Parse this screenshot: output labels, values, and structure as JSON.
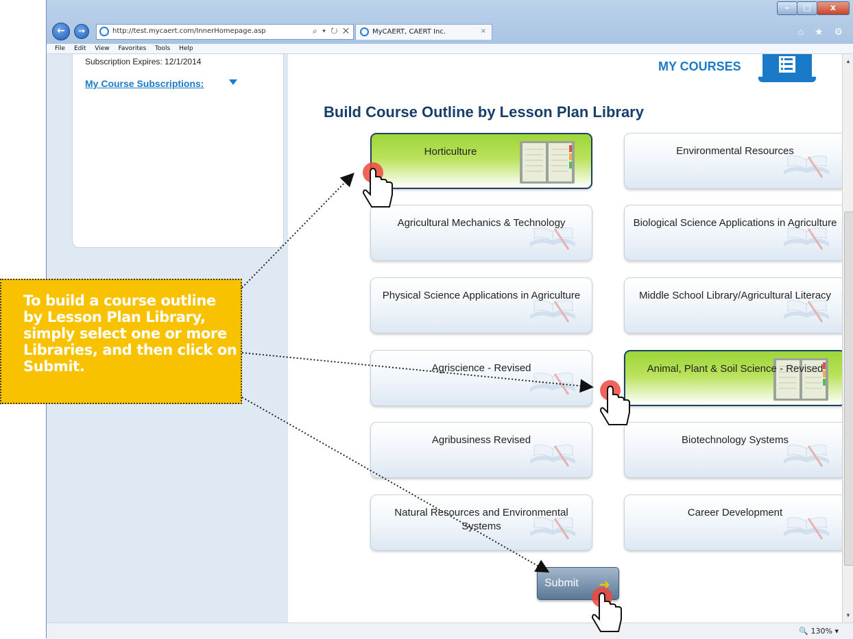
{
  "browser": {
    "url": "http://test.mycaert.com/InnerHomepage.asp",
    "tab_title": "MyCAERT, CAERT Inc.",
    "tab_close": "×",
    "address_controls": "⌕ ▾ ↻ ✕",
    "window_buttons": [
      "–",
      "□",
      "x"
    ],
    "nav": {
      "back": "←",
      "forward": "→"
    },
    "toolbar_icons": "⌂ ★ ⚙",
    "menu": [
      "File",
      "Edit",
      "View",
      "Favorites",
      "Tools",
      "Help"
    ],
    "zoom": "130%"
  },
  "sidebar": {
    "subscription_expires": "Subscription Expires: 12/1/2014",
    "my_course_subscriptions": "My Course Subscriptions:"
  },
  "header": {
    "my_courses": "MY COURSES",
    "page_heading": "Build Course Outline by Lesson Plan Library"
  },
  "libraries": [
    {
      "label": "Horticulture",
      "selected": true
    },
    {
      "label": "Environmental Resources",
      "selected": false
    },
    {
      "label": "Agricultural Mechanics & Technology",
      "selected": false
    },
    {
      "label": "Biological Science Applications in Agriculture",
      "selected": false
    },
    {
      "label": "Physical Science Applications in Agriculture",
      "selected": false
    },
    {
      "label": "Middle School Library/Agricultural Literacy",
      "selected": false
    },
    {
      "label": "Agriscience - Revised",
      "selected": false
    },
    {
      "label": "Animal, Plant & Soil Science - Revised",
      "selected": true
    },
    {
      "label": "Agribusiness Revised",
      "selected": false
    },
    {
      "label": "Biotechnology Systems",
      "selected": false
    },
    {
      "label": "Natural Resources and Environmental Systems",
      "selected": false
    },
    {
      "label": "Career Development",
      "selected": false
    }
  ],
  "submit": {
    "label": "Submit"
  },
  "callout": {
    "text": "To build a course outline by Lesson Plan Library, simply select one or more Libraries, and then click on Submit."
  },
  "colors": {
    "accent": "#1a7ac7",
    "heading": "#163e6a",
    "selected_green": "#9dd63a",
    "callout": "#f8c200",
    "cursor_red": "#f0483c"
  }
}
